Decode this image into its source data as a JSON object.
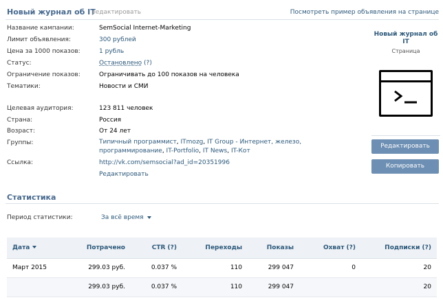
{
  "header": {
    "title": "Новый журнал об IT",
    "edit_label": "редактировать",
    "preview_link": "Посмотреть пример объявления на странице"
  },
  "info": {
    "campaign": {
      "label": "Название кампании:",
      "value": "SemSocial Internet-Marketing"
    },
    "limit": {
      "label": "Лимит объявления:",
      "value": "300 рублей"
    },
    "price": {
      "label": "Цена за 1000 показов:",
      "value": "1 рубль"
    },
    "status": {
      "label": "Статус:",
      "value": "Остановлено",
      "help": "(?)"
    },
    "restriction": {
      "label": "Ограничение показов:",
      "value": "Ограничивать до 100 показов на человека"
    },
    "topics": {
      "label": "Тематики:",
      "value": "Новости и СМИ"
    },
    "audience": {
      "label": "Целевая аудитория:",
      "value": "123 811 человек"
    },
    "country": {
      "label": "Страна:",
      "value": "Россия"
    },
    "age": {
      "label": "Возраст:",
      "value": "От 24 лет"
    },
    "groups": {
      "label": "Группы:",
      "items": [
        "Типичный программист",
        "ITmozg",
        "IT Group - Интернет, железо, программирование",
        "IT-Portfolio",
        "IT News",
        "IT-Кот"
      ]
    },
    "link": {
      "label": "Ссылка:",
      "value": "http://vk.com/semsocial?ad_id=20351996"
    },
    "edit_link": "Редактировать"
  },
  "preview": {
    "title": "Новый журнал об IT",
    "subtitle": "Страница",
    "image_icon": "terminal-icon",
    "edit_button": "Редактировать",
    "copy_button": "Копировать"
  },
  "stats": {
    "title": "Статистика",
    "period_label": "Период статистики:",
    "period_value": "За всё время",
    "columns": [
      "Дата",
      "Потрачено",
      "CTR (?)",
      "Переходы",
      "Показы",
      "Охват (?)",
      "Подписки (?)"
    ],
    "rows": [
      [
        "Март 2015",
        "299.03 руб.",
        "0.037 %",
        "110",
        "299 047",
        "0",
        "20"
      ]
    ],
    "total": [
      "",
      "299.03 руб.",
      "0.037 %",
      "110",
      "299 047",
      "",
      "20"
    ]
  },
  "colors": {
    "accent": "#45688e",
    "link": "#2b587a",
    "button": "#6d8fb3"
  }
}
